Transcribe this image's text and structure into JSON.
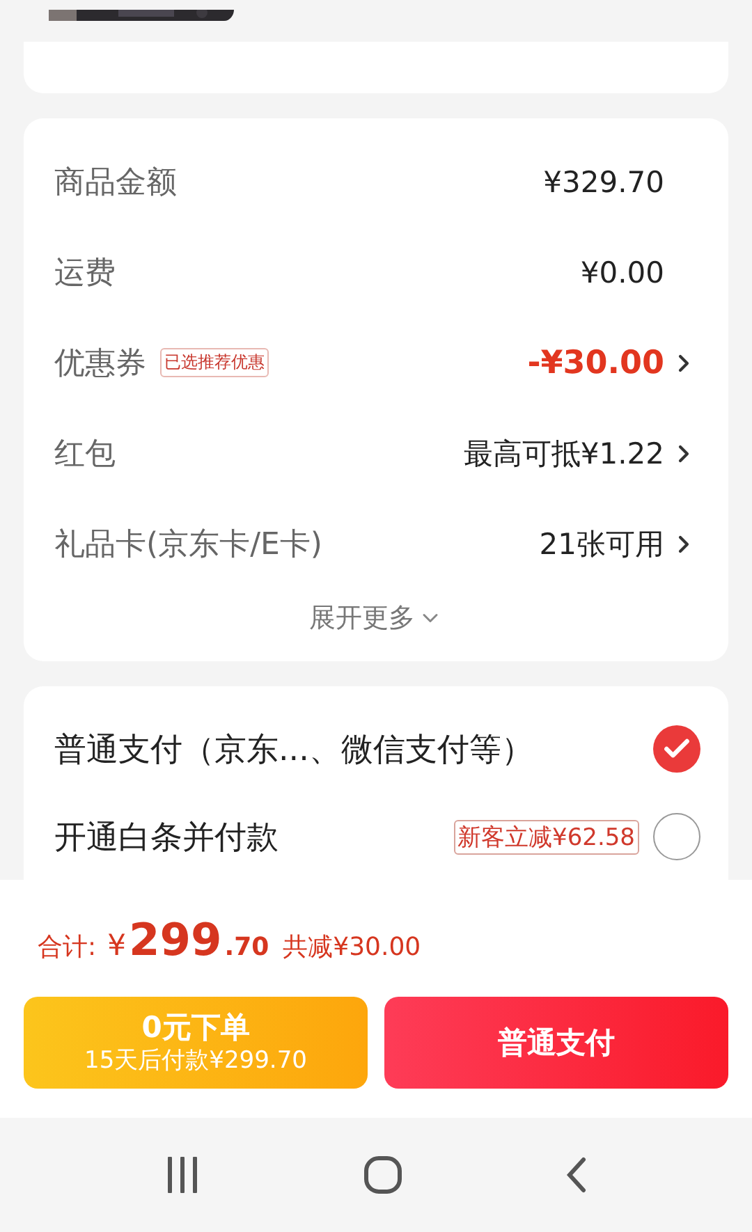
{
  "summary": {
    "rows": [
      {
        "label": "商品金额",
        "value": "¥329.70",
        "highlight": false,
        "chevron": false
      },
      {
        "label": "运费",
        "value": "¥0.00",
        "highlight": false,
        "chevron": false
      },
      {
        "label": "优惠券",
        "tag": "已选推荐优惠",
        "value": "-¥30.00",
        "highlight": true,
        "chevron": true
      },
      {
        "label": "红包",
        "value": "最高可抵¥1.22",
        "highlight": false,
        "chevron": true
      },
      {
        "label": "礼品卡(京东卡/E卡)",
        "value": "21张可用",
        "highlight": false,
        "chevron": true
      }
    ],
    "expand": "展开更多"
  },
  "payment_methods": [
    {
      "label": "普通支付（京东...、微信支付等）",
      "selected": true
    },
    {
      "label": "开通白条并付款",
      "promo": "新客立减¥62.58",
      "selected": false
    }
  ],
  "footer": {
    "total_label": "合计:",
    "currency": "¥",
    "total_int": "299",
    "total_dec": ".70",
    "discount": "共减¥30.00"
  },
  "buttons": [
    {
      "kind": "later",
      "title": "0元下单",
      "subtitle": "15天后付款¥299.70"
    },
    {
      "kind": "pay",
      "title": "普通支付"
    }
  ]
}
